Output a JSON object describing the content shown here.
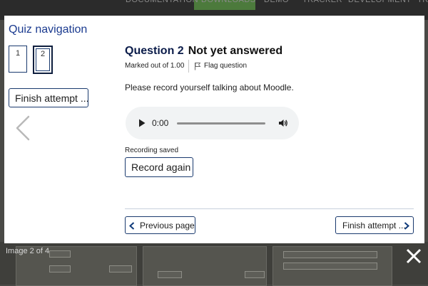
{
  "background_nav": {
    "items": [
      "DOCUMENTATION",
      "DOWNLOADS",
      "DEMO",
      "TRACKER",
      "DEVELOPMENT",
      "TR"
    ],
    "active_color": "#4c7a3c"
  },
  "quiz_nav": {
    "title": "Quiz navigation",
    "questions": [
      "1",
      "2"
    ],
    "finish_label": "Finish attempt ..."
  },
  "question": {
    "title": "Question 2",
    "status": "Not yet answered",
    "marks": "Marked out of 1.00",
    "flag_label": "Flag question",
    "prompt": "Please record yourself talking about Moodle."
  },
  "audio": {
    "time": "0:00",
    "icons": [
      "play-icon",
      "volume-icon"
    ]
  },
  "recording": {
    "saved_text": "Recording saved",
    "record_again_label": "Record again"
  },
  "footer": {
    "prev_label": "Previous page",
    "finish_label": "Finish attempt ..."
  },
  "lightbox": {
    "caption": "Image 2 of 4"
  },
  "colors": {
    "accent": "#0f6cbf",
    "title": "#0b1c4a",
    "nav_title": "#1a3a8f",
    "overlay": "#4a4a46"
  }
}
